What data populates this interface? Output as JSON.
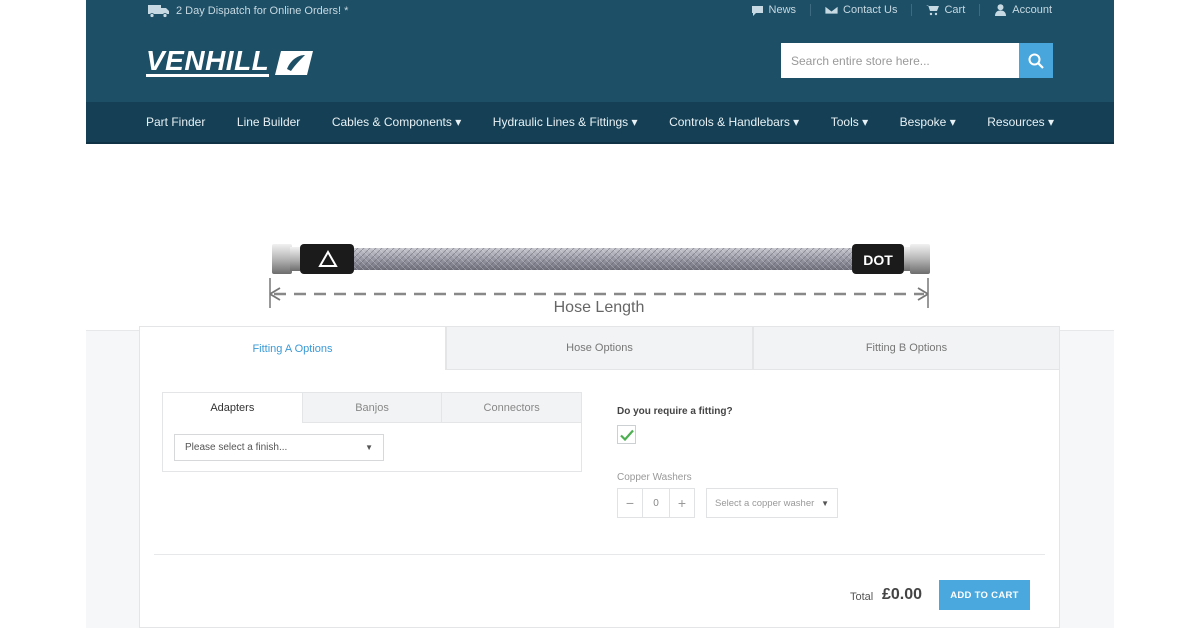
{
  "topbar": {
    "dispatch_text": "2 Day Dispatch for Online Orders! *",
    "links": [
      {
        "label": "News",
        "icon": "news-icon"
      },
      {
        "label": "Contact Us",
        "icon": "envelope-icon"
      },
      {
        "label": "Cart",
        "icon": "cart-icon"
      },
      {
        "label": "Account",
        "icon": "user-icon"
      }
    ]
  },
  "logo": {
    "text": "VENHILL"
  },
  "search": {
    "placeholder": "Search entire store here..."
  },
  "nav": {
    "items": [
      "Part Finder",
      "Line Builder",
      "Cables & Components ▾",
      "Hydraulic Lines & Fittings ▾",
      "Controls & Handlebars ▾",
      "Tools ▾",
      "Bespoke ▾",
      "Resources ▾"
    ]
  },
  "hose": {
    "dot_label": "DOT",
    "length_label": "Hose Length"
  },
  "tabs": [
    "Fitting A Options",
    "Hose Options",
    "Fitting B Options"
  ],
  "subtabs": [
    "Adapters",
    "Banjos",
    "Connectors"
  ],
  "finish_select": {
    "value": "Please select a finish..."
  },
  "fitting": {
    "question": "Do you require a fitting?",
    "checked": true
  },
  "washers": {
    "label": "Copper Washers",
    "quantity": "0",
    "minus": "−",
    "plus": "+",
    "select_value": "Select a copper washer"
  },
  "total": {
    "label": "Total",
    "value": "£0.00"
  },
  "cart_button": {
    "label": "ADD TO CART"
  },
  "colors": {
    "header": "#1d4f66",
    "nav": "#143f54",
    "accent": "#49a6dc",
    "check": "#4caf50"
  }
}
